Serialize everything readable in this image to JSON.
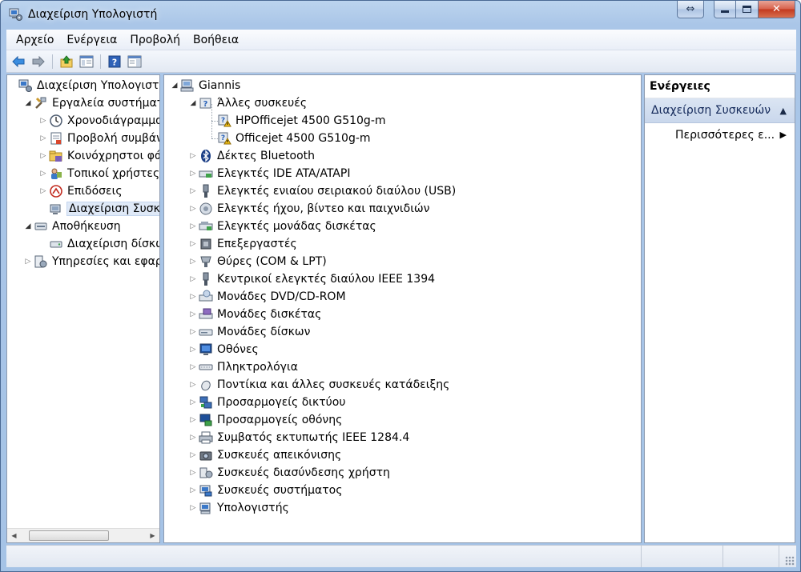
{
  "window": {
    "title": "Διαχείριση Υπολογιστή"
  },
  "menu": [
    "Αρχείο",
    "Ενέργεια",
    "Προβολή",
    "Βοήθεια"
  ],
  "toolbar": [
    "back-arrow-icon",
    "forward-arrow-icon",
    "up-folder-icon",
    "show-hide-console-tree-icon",
    "help-icon",
    "properties-pane-icon"
  ],
  "left_tree": [
    {
      "label": "Διαχείριση Υπολογιστή (",
      "icon": "computer-management-icon",
      "expander": "",
      "indent": 0
    },
    {
      "label": "Εργαλεία συστήματος",
      "icon": "system-tools-icon",
      "expander": "open",
      "indent": 1
    },
    {
      "label": "Χρονοδιάγραμμα ε",
      "icon": "clock-icon",
      "expander": "closed",
      "indent": 2
    },
    {
      "label": "Προβολή συμβάντ",
      "icon": "event-viewer-icon",
      "expander": "closed",
      "indent": 2
    },
    {
      "label": "Κοινόχρηστοι φάκ",
      "icon": "shared-folders-icon",
      "expander": "closed",
      "indent": 2
    },
    {
      "label": "Τοπικοί χρήστες κ",
      "icon": "local-users-icon",
      "expander": "closed",
      "indent": 2
    },
    {
      "label": "Επιδόσεις",
      "icon": "performance-icon",
      "expander": "closed",
      "indent": 2
    },
    {
      "label": "Διαχείριση Συσκευ",
      "icon": "device-manager-icon",
      "expander": "",
      "indent": 2,
      "selected": true
    },
    {
      "label": "Αποθήκευση",
      "icon": "storage-icon",
      "expander": "open",
      "indent": 1
    },
    {
      "label": "Διαχείριση δίσκων",
      "icon": "disk-management-icon",
      "expander": "",
      "indent": 2
    },
    {
      "label": "Υπηρεσίες και εφαρμ",
      "icon": "services-icon",
      "expander": "closed",
      "indent": 1
    }
  ],
  "device_tree": [
    {
      "label": "Giannis",
      "icon": "computer-icon",
      "expander": "open",
      "indent": 0
    },
    {
      "label": "Άλλες συσκευές",
      "icon": "unknown-device-icon",
      "expander": "open",
      "indent": 1
    },
    {
      "label": "HPOfficejet 4500 G510g-m",
      "icon": "warning-device-icon",
      "expander": "",
      "indent": 2
    },
    {
      "label": "Officejet 4500 G510g-m",
      "icon": "warning-device-icon",
      "expander": "",
      "indent": 2
    },
    {
      "label": "Δέκτες Bluetooth",
      "icon": "bluetooth-icon",
      "expander": "closed",
      "indent": 1
    },
    {
      "label": "Ελεγκτές IDE ATA/ATAPI",
      "icon": "ide-controller-icon",
      "expander": "closed",
      "indent": 1
    },
    {
      "label": "Ελεγκτές ενιαίου σειριακού διαύλου (USB)",
      "icon": "usb-icon",
      "expander": "closed",
      "indent": 1
    },
    {
      "label": "Ελεγκτές ήχου, βίντεο και παιχνιδιών",
      "icon": "speaker-icon",
      "expander": "closed",
      "indent": 1
    },
    {
      "label": "Ελεγκτές μονάδας δισκέτας",
      "icon": "floppy-controller-icon",
      "expander": "closed",
      "indent": 1
    },
    {
      "label": "Επεξεργαστές",
      "icon": "processor-icon",
      "expander": "closed",
      "indent": 1
    },
    {
      "label": "Θύρες (COM & LPT)",
      "icon": "port-icon",
      "expander": "closed",
      "indent": 1
    },
    {
      "label": "Κεντρικοί ελεγκτές διαύλου IEEE 1394",
      "icon": "firewire-icon",
      "expander": "closed",
      "indent": 1
    },
    {
      "label": "Μονάδες DVD/CD-ROM",
      "icon": "dvd-drive-icon",
      "expander": "closed",
      "indent": 1
    },
    {
      "label": "Μονάδες δισκέτας",
      "icon": "floppy-drive-icon",
      "expander": "closed",
      "indent": 1
    },
    {
      "label": "Μονάδες δίσκων",
      "icon": "disk-drive-icon",
      "expander": "closed",
      "indent": 1
    },
    {
      "label": "Οθόνες",
      "icon": "monitor-icon",
      "expander": "closed",
      "indent": 1
    },
    {
      "label": "Πληκτρολόγια",
      "icon": "keyboard-icon",
      "expander": "closed",
      "indent": 1
    },
    {
      "label": "Ποντίκια και άλλες συσκευές κατάδειξης",
      "icon": "mouse-icon",
      "expander": "closed",
      "indent": 1
    },
    {
      "label": "Προσαρμογείς δικτύου",
      "icon": "network-adapter-icon",
      "expander": "closed",
      "indent": 1
    },
    {
      "label": "Προσαρμογείς οθόνης",
      "icon": "display-adapter-icon",
      "expander": "closed",
      "indent": 1
    },
    {
      "label": "Συμβατός εκτυπωτής IEEE 1284.4",
      "icon": "printer-icon",
      "expander": "closed",
      "indent": 1
    },
    {
      "label": "Συσκευές απεικόνισης",
      "icon": "camera-icon",
      "expander": "closed",
      "indent": 1
    },
    {
      "label": "Συσκευές διασύνδεσης χρήστη",
      "icon": "hid-icon",
      "expander": "closed",
      "indent": 1
    },
    {
      "label": "Συσκευές συστήματος",
      "icon": "system-device-icon",
      "expander": "closed",
      "indent": 1
    },
    {
      "label": "Υπολογιστής",
      "icon": "computer-small-icon",
      "expander": "closed",
      "indent": 1
    }
  ],
  "actions": {
    "header": "Ενέργειες",
    "section": "Διαχείριση Συσκευών",
    "items": [
      "Περισσότερες ε..."
    ]
  },
  "colors": {
    "selection": "#dfe9f7",
    "frame": "#a5c3e6",
    "actions_section": "#c9d7ec"
  }
}
